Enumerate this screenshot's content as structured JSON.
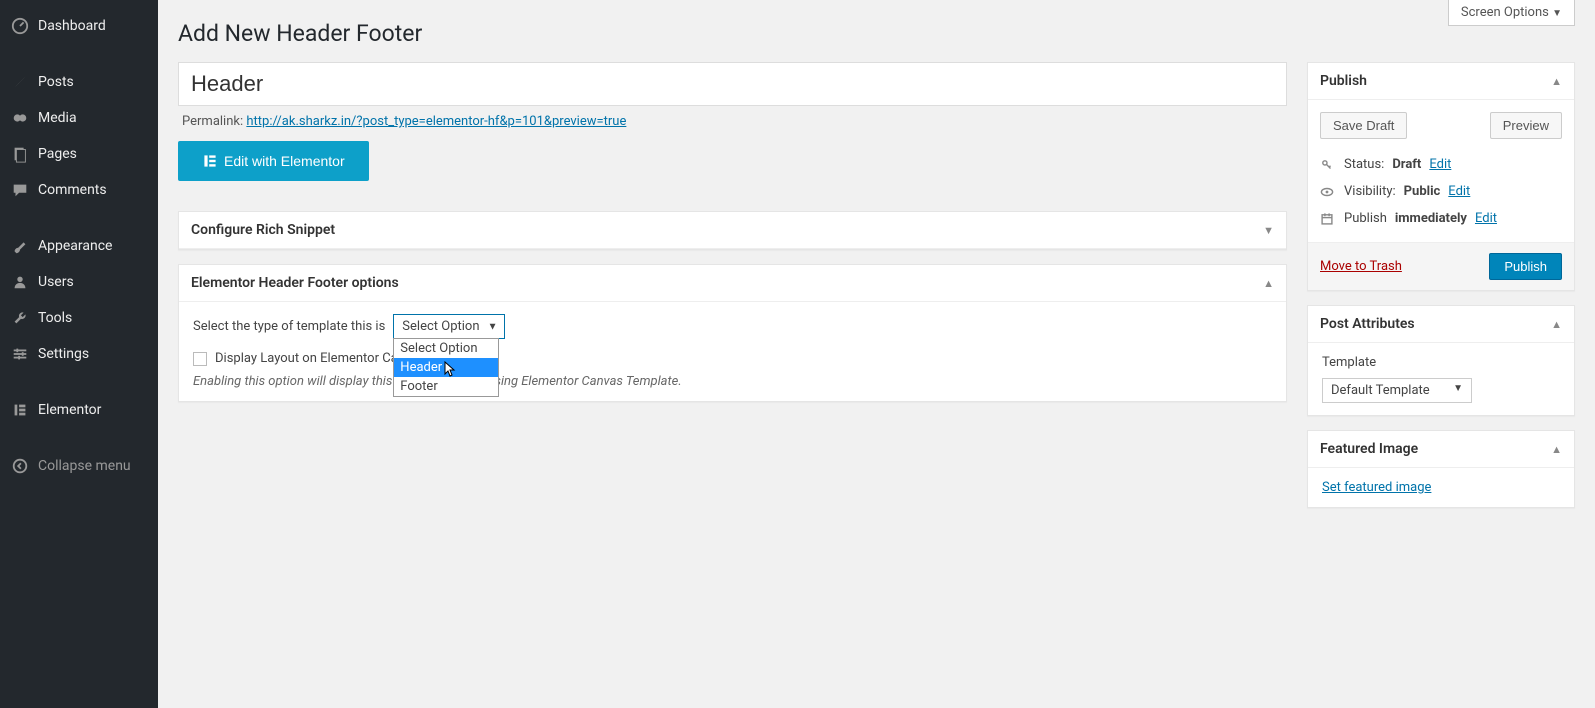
{
  "sidebar": {
    "items": [
      {
        "label": "Dashboard"
      },
      {
        "label": "Posts"
      },
      {
        "label": "Media"
      },
      {
        "label": "Pages"
      },
      {
        "label": "Comments"
      },
      {
        "label": "Appearance"
      },
      {
        "label": "Users"
      },
      {
        "label": "Tools"
      },
      {
        "label": "Settings"
      },
      {
        "label": "Elementor"
      },
      {
        "label": "Collapse menu"
      }
    ]
  },
  "screen_options": "Screen Options",
  "page_title": "Add New Header Footer",
  "title_value": "Header",
  "permalink_label": "Permalink:",
  "permalink_url": "http://ak.sharkz.in/?post_type=elementor-hf&p=101&preview=true",
  "edit_elementor_btn": "Edit with Elementor",
  "box_rich_snippet": "Configure Rich Snippet",
  "box_options_title": "Elementor Header Footer options",
  "select_label": "Select the type of template this is",
  "select_value": "Select Option",
  "dropdown_options": {
    "opt0": "Select Option",
    "opt1": "Header",
    "opt2": "Footer"
  },
  "checkbox_label": "Display Layout on Elementor Canvas Template?",
  "help_text": "Enabling this option will display this layout on pages using Elementor Canvas Template.",
  "publish": {
    "title": "Publish",
    "save_draft": "Save Draft",
    "preview": "Preview",
    "status_label": "Status:",
    "status_value": "Draft",
    "visibility_label": "Visibility:",
    "visibility_value": "Public",
    "publish_label": "Publish",
    "publish_value": "immediately",
    "edit": "Edit",
    "trash": "Move to Trash",
    "publish_btn": "Publish"
  },
  "post_attributes": {
    "title": "Post Attributes",
    "template_label": "Template",
    "template_value": "Default Template"
  },
  "featured": {
    "title": "Featured Image",
    "link": "Set featured image"
  }
}
